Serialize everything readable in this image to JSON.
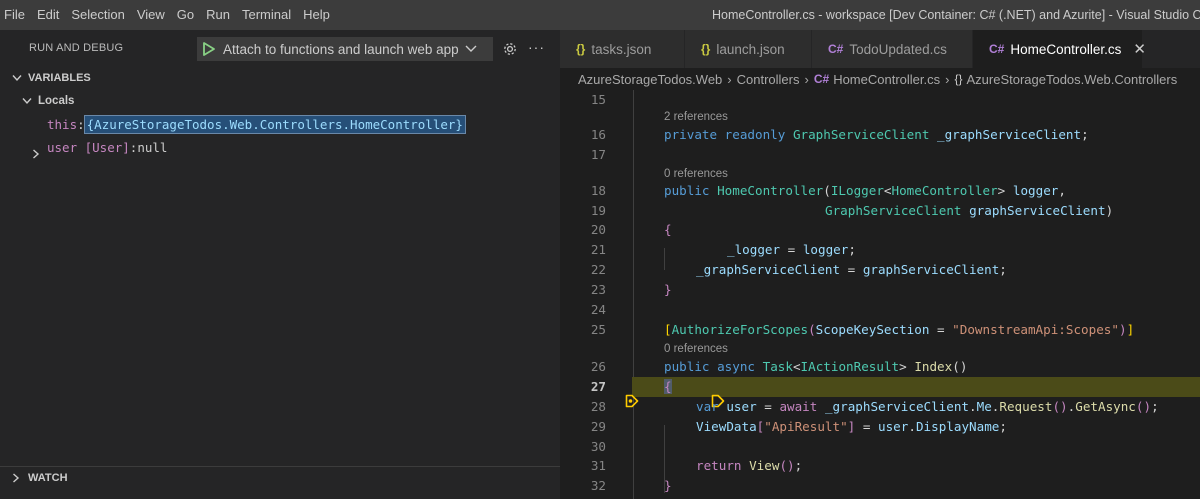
{
  "menu": [
    "File",
    "Edit",
    "Selection",
    "View",
    "Go",
    "Run",
    "Terminal",
    "Help"
  ],
  "window_title": "HomeController.cs - workspace [Dev Container: C# (.NET) and Azurite] - Visual Studio Code",
  "debug": {
    "title": "RUN AND DEBUG",
    "launch_config": "Attach to functions and launch web app",
    "more": "···"
  },
  "variables": {
    "header": "VARIABLES",
    "locals_header": "Locals",
    "items": [
      {
        "name": "this",
        "sep": ": ",
        "value": "{AzureStorageTodos.Web.Controllers.HomeController}"
      },
      {
        "name": "user [User]",
        "sep": ": ",
        "value": "null"
      }
    ]
  },
  "watch": {
    "header": "WATCH"
  },
  "tabs": [
    {
      "icon": "{}",
      "label": "tasks.json"
    },
    {
      "icon": "{}",
      "label": "launch.json"
    },
    {
      "icon": "C#",
      "label": "TodoUpdated.cs"
    },
    {
      "icon": "C#",
      "label": "HomeController.cs",
      "close": "✕"
    }
  ],
  "breadcrumb": [
    "AzureStorageTodos.Web",
    "Controllers",
    "HomeController.cs",
    "AzureStorageTodos.Web.Controllers"
  ],
  "breadcrumb_icons": {
    "file": "C#",
    "namespace": "{}"
  },
  "code": {
    "lines": [
      {
        "n": "15"
      },
      {
        "n": "16",
        "lens": "2 references"
      },
      {
        "n": "17"
      },
      {
        "n": "18",
        "lens": "0 references"
      },
      {
        "n": "19"
      },
      {
        "n": "20"
      },
      {
        "n": "21"
      },
      {
        "n": "22"
      },
      {
        "n": "23"
      },
      {
        "n": "24"
      },
      {
        "n": "25"
      },
      {
        "n": "26",
        "lens": "0 references"
      },
      {
        "n": "27"
      },
      {
        "n": "28"
      },
      {
        "n": "29"
      },
      {
        "n": "30"
      },
      {
        "n": "31"
      },
      {
        "n": "32"
      }
    ],
    "current_line": "27",
    "tokens": {
      "l16": [
        "private",
        " ",
        "readonly",
        " ",
        "GraphServiceClient",
        " ",
        "_graphServiceClient",
        ";"
      ],
      "l18": [
        "public",
        " ",
        "HomeController",
        "(",
        "ILogger",
        "<",
        "HomeController",
        ">",
        " ",
        "logger",
        ","
      ],
      "l19": [
        "GraphServiceClient",
        " ",
        "graphServiceClient",
        ")"
      ],
      "l20": [
        "{"
      ],
      "l21": [
        "_logger",
        " = ",
        "logger",
        ";"
      ],
      "l22": [
        "_graphServiceClient",
        " = ",
        "graphServiceClient",
        ";"
      ],
      "l23": [
        "}"
      ],
      "l25": [
        "[",
        "AuthorizeForScopes",
        "(",
        "ScopeKeySection",
        " = ",
        "\"DownstreamApi:Scopes\"",
        ")",
        "]"
      ],
      "l26": [
        "public",
        " ",
        "async",
        " ",
        "Task",
        "<",
        "IActionResult",
        ">",
        " ",
        "Index",
        "(",
        ")"
      ],
      "l27": [
        "{"
      ],
      "l28": [
        "var",
        " ",
        "user",
        " = ",
        "await",
        " ",
        "_graphServiceClient",
        ".",
        "Me",
        ".",
        "Request",
        "(",
        ")",
        ".",
        "GetAsync",
        "(",
        ")",
        ";"
      ],
      "l29": [
        "ViewData",
        "[",
        "\"ApiResult\"",
        "]",
        " = ",
        "user",
        ".",
        "DisplayName",
        ";"
      ],
      "l31": [
        "return",
        " ",
        "View",
        "(",
        ")",
        ";"
      ],
      "l32": [
        "}"
      ]
    }
  },
  "colors": {
    "accent_blue": "#007acc",
    "current_line_bg": "#4b4b18",
    "breakpoint_yellow": "#ffcc00"
  }
}
